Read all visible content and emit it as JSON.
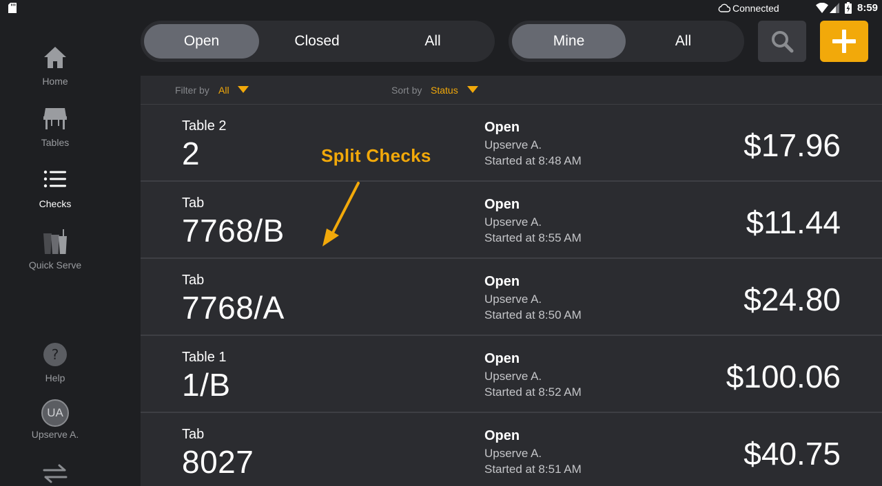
{
  "status_bar": {
    "cloud_icon": "cloud-icon",
    "connection": "Connected",
    "time": "8:59"
  },
  "sidebar": {
    "items": [
      {
        "label": "Home",
        "icon": "home-icon",
        "active": false
      },
      {
        "label": "Tables",
        "icon": "table-icon",
        "active": false
      },
      {
        "label": "Checks",
        "icon": "list-icon",
        "active": true
      },
      {
        "label": "Quick Serve",
        "icon": "cups-icon",
        "active": false
      }
    ],
    "help_label": "Help",
    "user_initials": "UA",
    "user_name": "Upserve A."
  },
  "status_filter": {
    "options": [
      "Open",
      "Closed",
      "All"
    ],
    "selected": "Open"
  },
  "owner_filter": {
    "options": [
      "Mine",
      "All"
    ],
    "selected": "Mine"
  },
  "filter_bar": {
    "filter_label": "Filter by",
    "filter_value": "All",
    "sort_label": "Sort by",
    "sort_value": "Status"
  },
  "checks": [
    {
      "kind": "Table 2",
      "name": "2",
      "status": "Open",
      "server": "Upserve A.",
      "started": "Started at 8:48 AM",
      "amount": "$17.96"
    },
    {
      "kind": "Tab",
      "name": "7768/B",
      "status": "Open",
      "server": "Upserve A.",
      "started": "Started at 8:55 AM",
      "amount": "$11.44"
    },
    {
      "kind": "Tab",
      "name": "7768/A",
      "status": "Open",
      "server": "Upserve A.",
      "started": "Started at 8:50 AM",
      "amount": "$24.80"
    },
    {
      "kind": "Table 1",
      "name": "1/B",
      "status": "Open",
      "server": "Upserve A.",
      "started": "Started at 8:52 AM",
      "amount": "$100.06"
    },
    {
      "kind": "Tab",
      "name": "8027",
      "status": "Open",
      "server": "Upserve A.",
      "started": "Started at 8:51 AM",
      "amount": "$40.75"
    }
  ],
  "annotation": {
    "text": "Split Checks",
    "color": "#f2a90a"
  },
  "colors": {
    "accent": "#f2a90a",
    "background": "#1e1f22",
    "panel": "#2b2c30",
    "segment_active": "#666971"
  }
}
